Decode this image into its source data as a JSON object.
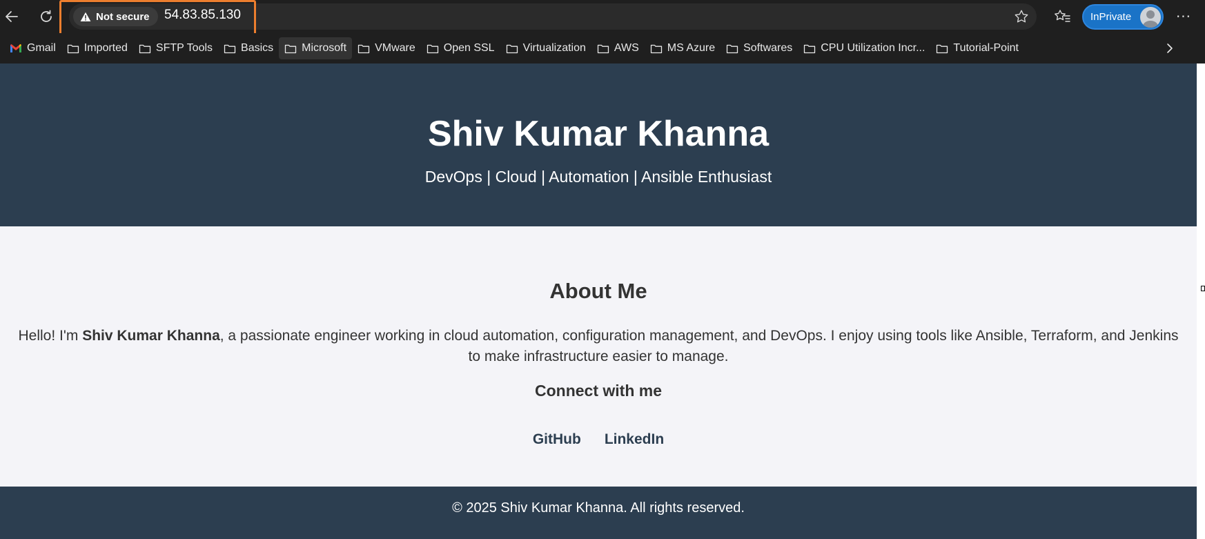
{
  "browser": {
    "security_label": "Not secure",
    "url": "54.83.85.130",
    "profile_label": "InPrivate",
    "more_label": "···",
    "icons": {
      "back": "back-arrow-icon",
      "refresh": "refresh-icon",
      "warning": "warning-icon",
      "star": "star-icon",
      "favorites": "favorites-icon",
      "avatar": "avatar-icon",
      "more": "more-icon",
      "chevron": "chevron-right-icon"
    },
    "colors": {
      "highlight_box": "#ec7e2e",
      "inprivate_badge": "#1a73c7"
    }
  },
  "bookmarks": [
    {
      "label": "Gmail"
    },
    {
      "label": "Imported"
    },
    {
      "label": "SFTP Tools"
    },
    {
      "label": "Basics"
    },
    {
      "label": "Microsoft"
    },
    {
      "label": "VMware"
    },
    {
      "label": "Open SSL"
    },
    {
      "label": "Virtualization"
    },
    {
      "label": "AWS"
    },
    {
      "label": "MS Azure"
    },
    {
      "label": "Softwares"
    },
    {
      "label": "CPU Utilization Incr..."
    },
    {
      "label": "Tutorial-Point"
    }
  ],
  "site": {
    "name": "Shiv Kumar Khanna",
    "tagline": "DevOps | Cloud | Automation | Ansible Enthusiast",
    "about": {
      "heading": "About Me",
      "bio_prefix": "Hello! I'm ",
      "bio_name": "Shiv Kumar Khanna",
      "bio_suffix": ", a passionate engineer working in cloud automation, configuration management, and DevOps. I enjoy using tools like Ansible, Terraform, and Jenkins to make infrastructure easier to manage."
    },
    "connect": {
      "heading": "Connect with me",
      "links": [
        {
          "label": "GitHub"
        },
        {
          "label": "LinkedIn"
        }
      ]
    },
    "footer": "© 2025 Shiv Kumar Khanna. All rights reserved.",
    "colors": {
      "header_bg": "#2c3e50",
      "body_bg": "#f4f4f8",
      "text": "#333333"
    }
  }
}
